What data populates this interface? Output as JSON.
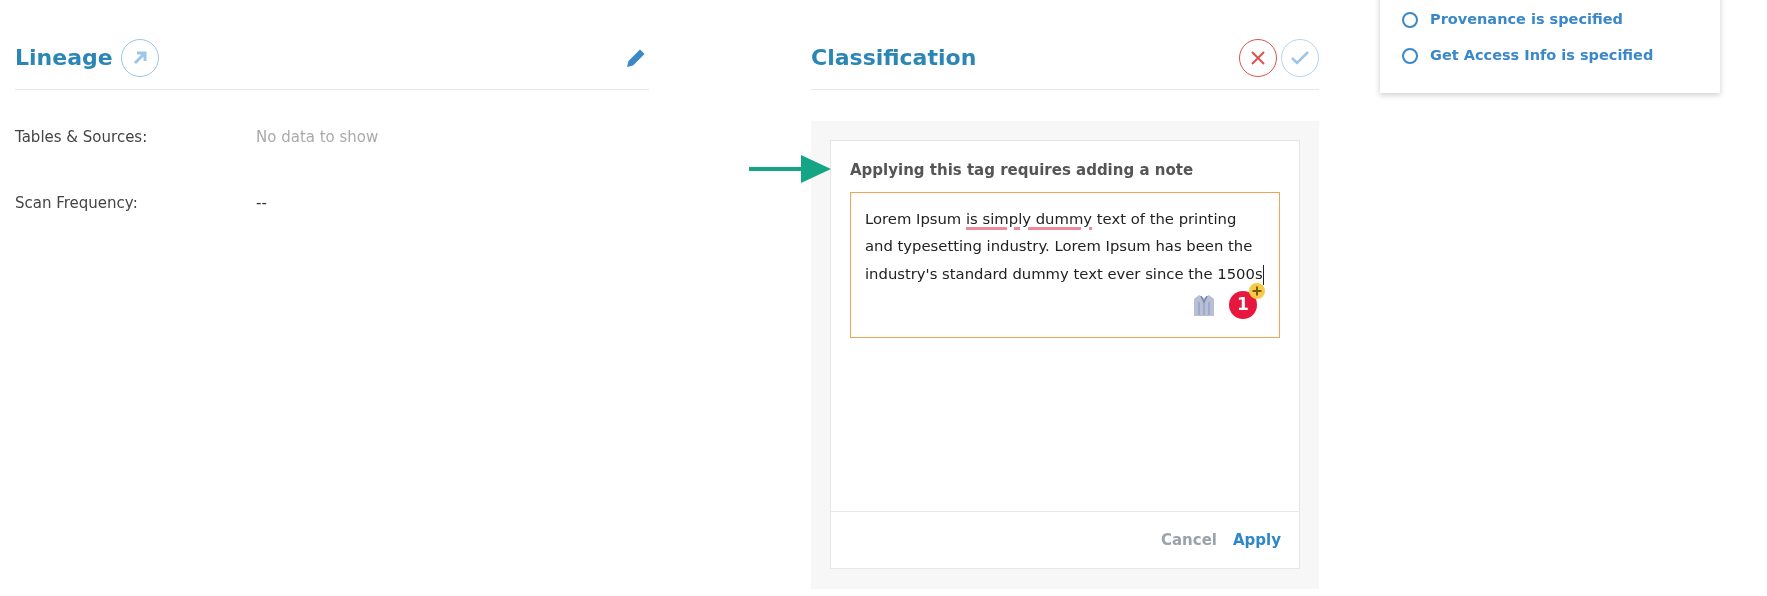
{
  "checklist": [
    {
      "label": "Provenance is specified",
      "checked": false
    },
    {
      "label": "Get Access Info is specified",
      "checked": false
    }
  ],
  "lineage": {
    "title": "Lineage",
    "fields": [
      {
        "label": "Tables & Sources:",
        "value": "No data to show",
        "empty": true
      },
      {
        "label": "Scan Frequency:",
        "value": "--",
        "empty": false
      }
    ]
  },
  "classification": {
    "title": "Classification",
    "note_card": {
      "heading": "Applying this tag requires adding a note",
      "note_segments": [
        {
          "text": "Lorem Ipsum ",
          "flagged": false
        },
        {
          "text": "is simply dummy",
          "flagged": true
        },
        {
          "text": " text of the printing and typesetting industry. Lorem Ipsum has been the industry's standard dummy text ever since the 1500s",
          "flagged": false
        }
      ],
      "badge_count": "1",
      "buttons": [
        {
          "label": "Cancel",
          "kind": "secondary"
        },
        {
          "label": "Apply",
          "kind": "primary"
        }
      ]
    }
  }
}
